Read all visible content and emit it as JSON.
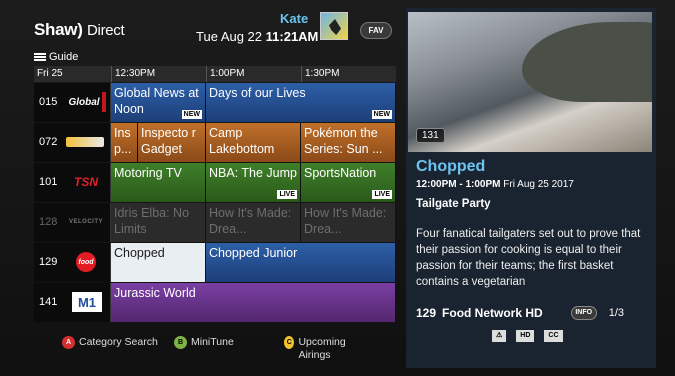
{
  "header": {
    "brand": "Shaw",
    "brand_suffix": "Direct",
    "user_name": "Kate",
    "date": "Tue Aug 22",
    "time": "11:21AM",
    "fav_label": "FAV",
    "guide_label": "Guide"
  },
  "timebar": {
    "day": "Fri 25",
    "slots": [
      "12:30PM",
      "1:00PM",
      "1:30PM"
    ]
  },
  "rows": [
    {
      "number": "015",
      "logo": "Global",
      "programs": [
        {
          "title": "Global News at Noon",
          "tag": "NEW"
        },
        {
          "title": "Days of our Lives",
          "tag": "NEW"
        }
      ]
    },
    {
      "number": "072",
      "logo": "",
      "programs": [
        {
          "title": "Ins p..."
        },
        {
          "title": "Inspecto r Gadget"
        },
        {
          "title": "Camp Lakebottom"
        },
        {
          "title": "Pokémon the Series: Sun ..."
        }
      ]
    },
    {
      "number": "101",
      "logo": "TSN",
      "programs": [
        {
          "title": "Motoring TV"
        },
        {
          "title": "NBA: The Jump",
          "tag": "LIVE"
        },
        {
          "title": "SportsNation",
          "tag": "LIVE"
        }
      ]
    },
    {
      "number": "128",
      "logo": "VELOCITY",
      "programs": [
        {
          "title": "Idris Elba: No Limits"
        },
        {
          "title": "How It's Made: Drea..."
        },
        {
          "title": "How It's Made: Drea..."
        }
      ]
    },
    {
      "number": "129",
      "logo": "food",
      "programs": [
        {
          "title": "Chopped"
        },
        {
          "title": "Chopped Junior"
        }
      ]
    },
    {
      "number": "141",
      "logo": "M1",
      "programs": [
        {
          "title": "Jurassic World"
        }
      ]
    }
  ],
  "legend": {
    "a_key": "A",
    "a_label": "Category Search",
    "b_key": "B",
    "b_label": "MiniTune",
    "c_key": "C",
    "c_label": "Upcoming Airings"
  },
  "preview": {
    "channel_overlay": "131"
  },
  "detail": {
    "title": "Chopped",
    "time": "12:00PM - 1:00PM",
    "date": "Fri Aug 25 2017",
    "episode": "Tailgate Party",
    "description": "Four fanatical tailgaters set out to prove that their passion for cooking is equal to their passion for their teams; the first basket contains a vegetarian",
    "channel_number": "129",
    "channel_name": "Food Network HD",
    "info_label": "INFO",
    "page": "1/3",
    "badges": [
      "HD",
      "CC"
    ]
  },
  "colors": {
    "accent": "#6cc3f0",
    "cat_blue": "#2d5fa8",
    "cat_orange": "#c0702a",
    "cat_green": "#3f7f2a",
    "cat_purple": "#7a3fa3"
  }
}
